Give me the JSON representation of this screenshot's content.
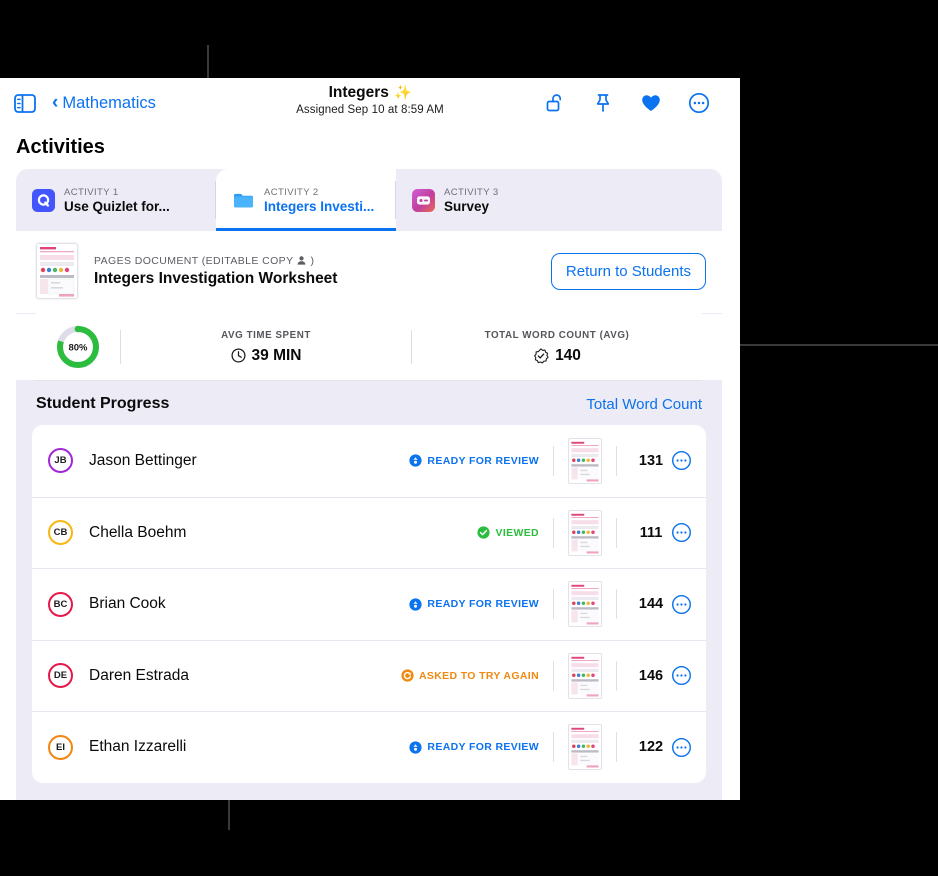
{
  "navbar": {
    "sidebar_toggle_name": "sidebar-toggle-icon",
    "back_label": "Mathematics",
    "title": "Integers",
    "title_emoji": "✨",
    "subtitle": "Assigned Sep 10 at 8:59 AM",
    "icons": [
      {
        "name": "unlock-icon",
        "label": "Unlock"
      },
      {
        "name": "pin-icon",
        "label": "Pin"
      },
      {
        "name": "heart-icon",
        "label": "Favorite"
      },
      {
        "name": "more-circle-icon",
        "label": "More"
      }
    ]
  },
  "section": {
    "heading": "Activities"
  },
  "tabs": [
    {
      "kicker": "ACTIVITY 1",
      "label": "Use Quizlet for...",
      "icon": "quizlet-icon",
      "active": false
    },
    {
      "kicker": "ACTIVITY 2",
      "label": "Integers Investi...",
      "icon": "folder-icon",
      "active": true
    },
    {
      "kicker": "ACTIVITY 3",
      "label": "Survey",
      "icon": "survey-icon",
      "active": false
    }
  ],
  "document": {
    "kicker": "PAGES DOCUMENT (EDITABLE COPY",
    "kicker_suffix": ")",
    "person_icon": "person-icon",
    "name": "Integers Investigation Worksheet",
    "return_button": "Return to Students"
  },
  "stats": {
    "ring": {
      "percent_label": "80%",
      "percent": 80,
      "color": "#2cbd3f",
      "track": "#dedce8"
    },
    "items": [
      {
        "label": "AVG TIME SPENT",
        "value": "39 MIN",
        "icon": "clock-icon"
      },
      {
        "label": "TOTAL WORD COUNT (AVG)",
        "value": "140",
        "icon": "seal-check-icon"
      }
    ]
  },
  "progress": {
    "title": "Student Progress",
    "link": "Total Word Count"
  },
  "students": [
    {
      "initials": "JB",
      "ring_color": "#a227d8",
      "name": "Jason Bettinger",
      "status": "READY FOR REVIEW",
      "status_color": "#0b72f0",
      "status_icon": "ready-icon",
      "count": "131"
    },
    {
      "initials": "CB",
      "ring_color": "#f5b810",
      "name": "Chella Boehm",
      "status": "VIEWED",
      "status_color": "#2cbd3f",
      "status_icon": "viewed-icon",
      "count": "111"
    },
    {
      "initials": "BC",
      "ring_color": "#e8174a",
      "name": "Brian Cook",
      "status": "READY FOR REVIEW",
      "status_color": "#0b72f0",
      "status_icon": "ready-icon",
      "count": "144"
    },
    {
      "initials": "DE",
      "ring_color": "#e8174a",
      "name": "Daren Estrada",
      "status": "ASKED TO TRY AGAIN",
      "status_color": "#f0890f",
      "status_icon": "retry-icon",
      "count": "146"
    },
    {
      "initials": "EI",
      "ring_color": "#f58410",
      "name": "Ethan Izzarelli",
      "status": "READY FOR REVIEW",
      "status_color": "#0b72f0",
      "status_icon": "ready-icon",
      "count": "122"
    }
  ],
  "colors": {
    "accent_blue": "#0b72f0",
    "panel": "#ecebf6",
    "green": "#2cbd3f",
    "orange": "#f0890f"
  }
}
